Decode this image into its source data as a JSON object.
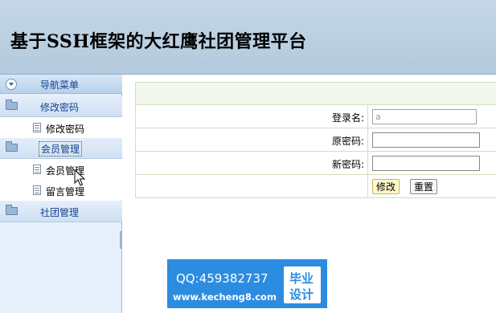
{
  "header": {
    "title": "基于SSH框架的大红鹰社团管理平台"
  },
  "sidebar": {
    "nav_title": "导航菜单",
    "groups": [
      {
        "label": "修改密码",
        "items": [
          "修改密码"
        ]
      },
      {
        "label": "会员管理",
        "items": [
          "会员管理",
          "留言管理"
        ]
      },
      {
        "label": "社团管理",
        "items": []
      }
    ]
  },
  "form": {
    "username_label": "登录名:",
    "username_value": "a",
    "old_password_label": "原密码:",
    "old_password_value": "",
    "new_password_label": "新密码:",
    "new_password_value": "",
    "submit_label": "修改",
    "reset_label": "重置"
  },
  "watermark": {
    "qq": "QQ:459382737",
    "website": "www.kecheng8.com",
    "badge_line1": "毕业",
    "badge_line2": "设计"
  },
  "colors": {
    "header_bg": "#b9cfe2",
    "sidebar_bg": "#e6f1fb",
    "sidebar_text": "#15428b",
    "form_border": "#cfe0c0",
    "watermark_bg": "#2c8ce0"
  }
}
